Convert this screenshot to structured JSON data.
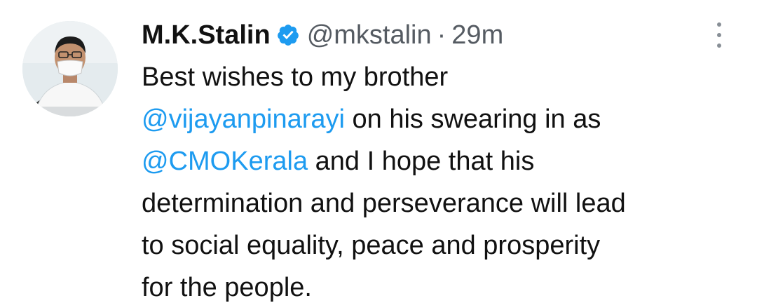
{
  "tweet": {
    "display_name": "M.K.Stalin",
    "handle": "@mkstalin",
    "separator": "·",
    "time": "29m",
    "verified": true,
    "accent_color": "#1d9bf0",
    "lines": {
      "l1": "Best wishes to my brother",
      "l2_mention": "@vijayanpinarayi",
      "l2_rest": " on his swearing in as",
      "l3_mention": "@CMOKerala",
      "l3_rest": " and I hope that his",
      "l4": "determination and perseverance will lead",
      "l5": "to social equality, peace and prosperity",
      "l6": "for the people."
    }
  },
  "icons": {
    "verified": "verified-badge-icon",
    "more": "more-options-icon"
  }
}
